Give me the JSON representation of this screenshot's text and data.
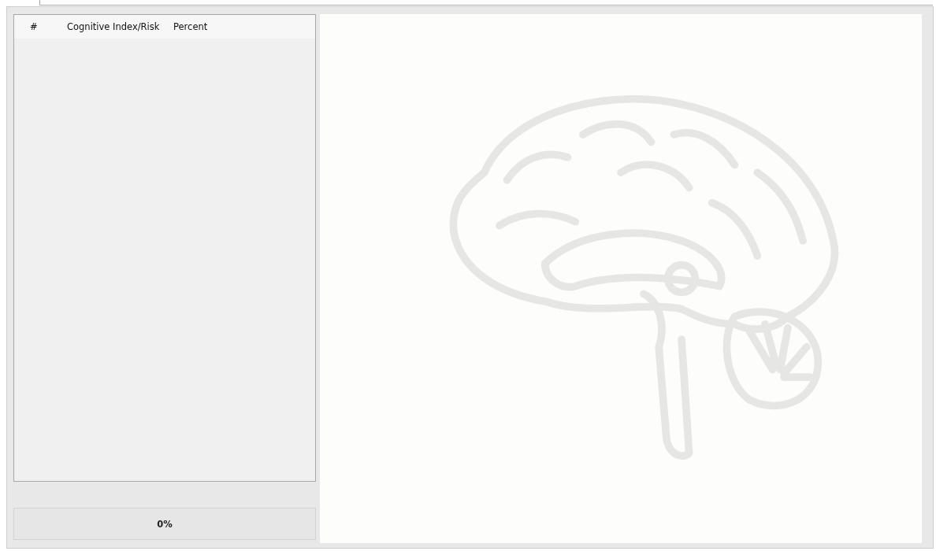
{
  "table": {
    "columns": [
      "#",
      "Cognitive Index/Risk",
      "Percent"
    ]
  },
  "progress": {
    "reading": "0%"
  }
}
